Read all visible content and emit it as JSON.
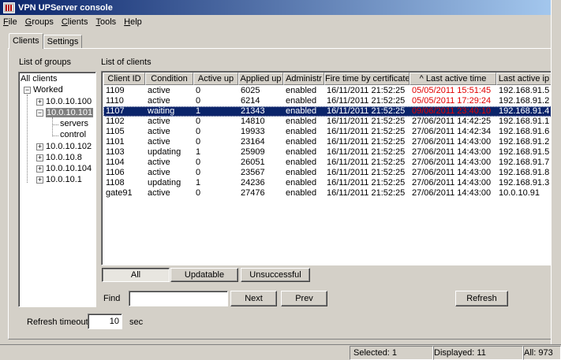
{
  "window": {
    "title": "VPN UPServer console"
  },
  "menu": [
    "File",
    "Groups",
    "Clients",
    "Tools",
    "Help"
  ],
  "tabs": [
    "Clients",
    "Settings"
  ],
  "groups_panel": {
    "label": "List of groups",
    "tree": {
      "root": "All clients",
      "worked": "Worked",
      "nodes": [
        "10.0.10.100",
        "10.0.10.101",
        "10.0.10.102",
        "10.0.10.8",
        "10.0.10.104",
        "10.0.10.1"
      ],
      "subnodes": [
        "servers",
        "control"
      ]
    }
  },
  "clients_panel": {
    "label": "List of clients",
    "columns": [
      "Client ID",
      "Condition",
      "Active up",
      "Applied up",
      "Administr",
      "Fire time by certificate",
      "^ Last active time",
      "Last active ip"
    ],
    "rows": [
      [
        "1109",
        "active",
        "0",
        "6025",
        "enabled",
        "16/11/2011 21:52:25",
        "05/05/2011 15:51:45",
        "192.168.91.5"
      ],
      [
        "1110",
        "active",
        "0",
        "6214",
        "enabled",
        "16/11/2011 21:52:25",
        "05/05/2011 17:29:24",
        "192.168.91.2"
      ],
      [
        "1107",
        "waiting",
        "1",
        "21343",
        "enabled",
        "16/11/2011 21:52:25",
        "09/06/2011 23:40:10",
        "192.168.91.4"
      ],
      [
        "1102",
        "active",
        "0",
        "14810",
        "enabled",
        "16/11/2011 21:52:25",
        "27/06/2011 14:42:25",
        "192.168.91.1"
      ],
      [
        "1105",
        "active",
        "0",
        "19933",
        "enabled",
        "16/11/2011 21:52:25",
        "27/06/2011 14:42:34",
        "192.168.91.6"
      ],
      [
        "1101",
        "active",
        "0",
        "23164",
        "enabled",
        "16/11/2011 21:52:25",
        "27/06/2011 14:43:00",
        "192.168.91.2"
      ],
      [
        "1103",
        "updating",
        "1",
        "25909",
        "enabled",
        "16/11/2011 21:52:25",
        "27/06/2011 14:43:00",
        "192.168.91.5"
      ],
      [
        "1104",
        "active",
        "0",
        "26051",
        "enabled",
        "16/11/2011 21:52:25",
        "27/06/2011 14:43:00",
        "192.168.91.7"
      ],
      [
        "1106",
        "active",
        "0",
        "23567",
        "enabled",
        "16/11/2011 21:52:25",
        "27/06/2011 14:43:00",
        "192.168.91.8"
      ],
      [
        "1108",
        "updating",
        "1",
        "24236",
        "enabled",
        "16/11/2011 21:52:25",
        "27/06/2011 14:43:00",
        "192.168.91.3"
      ],
      [
        "gate91",
        "active",
        "0",
        "27476",
        "enabled",
        "16/11/2011 21:52:25",
        "27/06/2011 14:43:00",
        "10.0.10.91"
      ]
    ],
    "selected_row": 2,
    "red_rows": [
      0,
      1,
      2
    ]
  },
  "filters": [
    "All",
    "Updatable",
    "Unsuccessful"
  ],
  "find": {
    "label": "Find",
    "value": "",
    "next": "Next",
    "prev": "Prev"
  },
  "refresh_button": "Refresh",
  "refresh_timeout": {
    "label": "Refresh timeout",
    "value": "10",
    "unit": "sec"
  },
  "status": {
    "selected": "Selected: 1",
    "displayed": "Displayed: 11",
    "all": "All: 973"
  },
  "colors": {
    "title_start": "#0a246a",
    "selection": "#0a246a",
    "stale_time": "#e00000",
    "face": "#d4d0c8"
  }
}
